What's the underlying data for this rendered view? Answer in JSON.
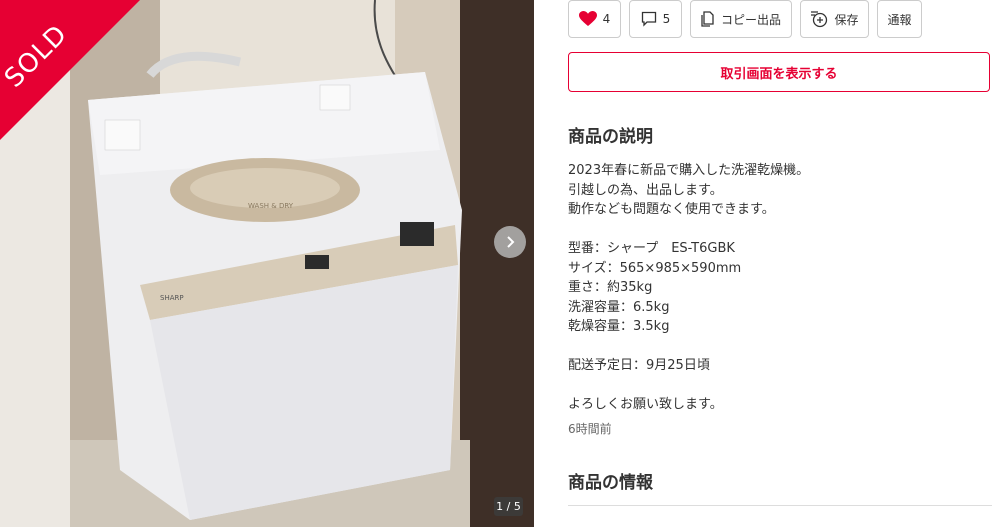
{
  "gallery": {
    "sold_label": "SOLD",
    "counter": "1 / 5",
    "photo_alt": "白い縦型洗濯乾燥機の写真",
    "appliance_brand": "SHARP",
    "appliance_lid_text": "WASH & DRY",
    "sold_color": "#e60033"
  },
  "actions": {
    "like_count": "4",
    "comment_count": "5",
    "copy_label": "コピー出品",
    "save_label": "保存",
    "report_label": "通報"
  },
  "trade_button": "取引画面を表示する",
  "description": {
    "title": "商品の説明",
    "body": "2023年春に新品で購入した洗濯乾燥機。\n引越しの為、出品します。\n動作なども問題なく使用できます。\n\n型番：シャープ　ES-T6GBK\nサイズ：565×985×590mm\n重さ：約35kg\n洗濯容量：6.5kg\n乾燥容量：3.5kg\n\n配送予定日：9月25日頃\n\nよろしくお願い致します。",
    "posted": "6時間前"
  },
  "info": {
    "title": "商品の情報"
  },
  "colors": {
    "accent": "#e60033"
  },
  "icons": [
    "heart-icon",
    "comment-icon",
    "copy-icon",
    "save-icon",
    "chevron-right-icon"
  ]
}
